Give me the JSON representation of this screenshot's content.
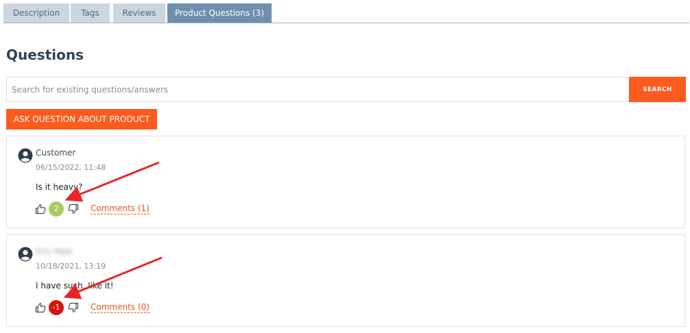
{
  "tabs": [
    {
      "label": "Description",
      "active": false
    },
    {
      "label": "Tags",
      "active": false
    },
    {
      "label": "Reviews",
      "active": false
    },
    {
      "label": "Product Questions (3)",
      "active": true
    }
  ],
  "section_title": "Questions",
  "search": {
    "placeholder": "Search for existing questions/answers",
    "value": "",
    "button_label": "SEARCH"
  },
  "ask_button_label": "ASK QUESTION ABOUT PRODUCT",
  "questions": [
    {
      "author": "Customer",
      "date": "06/15/2022, 11:48",
      "text": "Is it heavy?",
      "score": "2",
      "score_color": "#a7cb61",
      "comments_label": "Comments (1)"
    },
    {
      "author": "Eric Hale",
      "author_blurred": true,
      "date": "10/18/2021, 13:19",
      "text": "I have such, like it!",
      "score": "-1",
      "score_color": "#d9140c",
      "comments_label": "Comments (0)"
    }
  ],
  "colors": {
    "accent": "#fd5a1e",
    "tab_active": "#6e8fae",
    "tab_inactive": "#cbd6e0",
    "annotation_arrow": "#e8262a"
  },
  "icons": [
    "user-avatar-icon",
    "thumbs-up-icon",
    "thumbs-down-icon"
  ]
}
